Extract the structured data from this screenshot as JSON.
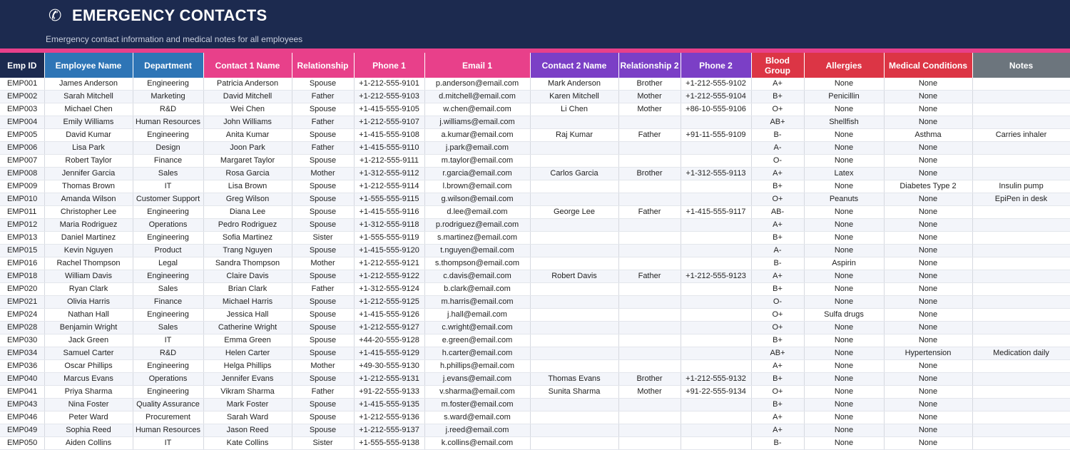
{
  "header": {
    "title": "EMERGENCY CONTACTS",
    "subtitle": "Emergency contact information and medical notes for all employees",
    "icon": "phone-icon"
  },
  "colors": {
    "navy": "#1c2a4f",
    "blue": "#2e75b6",
    "pink": "#e8408a",
    "purple": "#7b3fc6",
    "red": "#dc3545",
    "gray": "#6c757d"
  },
  "table": {
    "columns": [
      {
        "label": "Emp ID",
        "group": "navy"
      },
      {
        "label": "Employee Name",
        "group": "blue"
      },
      {
        "label": "Department",
        "group": "blue"
      },
      {
        "label": "Contact 1 Name",
        "group": "pink"
      },
      {
        "label": "Relationship",
        "group": "pink"
      },
      {
        "label": "Phone 1",
        "group": "pink"
      },
      {
        "label": "Email 1",
        "group": "pink"
      },
      {
        "label": "Contact 2 Name",
        "group": "purple"
      },
      {
        "label": "Relationship 2",
        "group": "purple"
      },
      {
        "label": "Phone 2",
        "group": "purple"
      },
      {
        "label": "Blood Group",
        "group": "red"
      },
      {
        "label": "Allergies",
        "group": "red"
      },
      {
        "label": "Medical Conditions",
        "group": "red"
      },
      {
        "label": "Notes",
        "group": "gray"
      }
    ],
    "rows": [
      [
        "EMP001",
        "James Anderson",
        "Engineering",
        "Patricia Anderson",
        "Spouse",
        "+1-212-555-9101",
        "p.anderson@email.com",
        "Mark Anderson",
        "Brother",
        "+1-212-555-9102",
        "A+",
        "None",
        "None",
        ""
      ],
      [
        "EMP002",
        "Sarah Mitchell",
        "Marketing",
        "David Mitchell",
        "Father",
        "+1-212-555-9103",
        "d.mitchell@email.com",
        "Karen Mitchell",
        "Mother",
        "+1-212-555-9104",
        "B+",
        "Penicillin",
        "None",
        ""
      ],
      [
        "EMP003",
        "Michael Chen",
        "R&D",
        "Wei Chen",
        "Spouse",
        "+1-415-555-9105",
        "w.chen@email.com",
        "Li Chen",
        "Mother",
        "+86-10-555-9106",
        "O+",
        "None",
        "None",
        ""
      ],
      [
        "EMP004",
        "Emily Williams",
        "Human Resources",
        "John Williams",
        "Father",
        "+1-212-555-9107",
        "j.williams@email.com",
        "",
        "",
        "",
        "AB+",
        "Shellfish",
        "None",
        ""
      ],
      [
        "EMP005",
        "David Kumar",
        "Engineering",
        "Anita Kumar",
        "Spouse",
        "+1-415-555-9108",
        "a.kumar@email.com",
        "Raj Kumar",
        "Father",
        "+91-11-555-9109",
        "B-",
        "None",
        "Asthma",
        "Carries inhaler"
      ],
      [
        "EMP006",
        "Lisa Park",
        "Design",
        "Joon Park",
        "Father",
        "+1-415-555-9110",
        "j.park@email.com",
        "",
        "",
        "",
        "A-",
        "None",
        "None",
        ""
      ],
      [
        "EMP007",
        "Robert Taylor",
        "Finance",
        "Margaret Taylor",
        "Spouse",
        "+1-212-555-9111",
        "m.taylor@email.com",
        "",
        "",
        "",
        "O-",
        "None",
        "None",
        ""
      ],
      [
        "EMP008",
        "Jennifer Garcia",
        "Sales",
        "Rosa Garcia",
        "Mother",
        "+1-312-555-9112",
        "r.garcia@email.com",
        "Carlos Garcia",
        "Brother",
        "+1-312-555-9113",
        "A+",
        "Latex",
        "None",
        ""
      ],
      [
        "EMP009",
        "Thomas Brown",
        "IT",
        "Lisa Brown",
        "Spouse",
        "+1-212-555-9114",
        "l.brown@email.com",
        "",
        "",
        "",
        "B+",
        "None",
        "Diabetes Type 2",
        "Insulin pump"
      ],
      [
        "EMP010",
        "Amanda Wilson",
        "Customer Support",
        "Greg Wilson",
        "Spouse",
        "+1-555-555-9115",
        "g.wilson@email.com",
        "",
        "",
        "",
        "O+",
        "Peanuts",
        "None",
        "EpiPen in desk"
      ],
      [
        "EMP011",
        "Christopher Lee",
        "Engineering",
        "Diana Lee",
        "Spouse",
        "+1-415-555-9116",
        "d.lee@email.com",
        "George Lee",
        "Father",
        "+1-415-555-9117",
        "AB-",
        "None",
        "None",
        ""
      ],
      [
        "EMP012",
        "Maria Rodriguez",
        "Operations",
        "Pedro Rodriguez",
        "Spouse",
        "+1-312-555-9118",
        "p.rodriguez@email.com",
        "",
        "",
        "",
        "A+",
        "None",
        "None",
        ""
      ],
      [
        "EMP013",
        "Daniel Martinez",
        "Engineering",
        "Sofia Martinez",
        "Sister",
        "+1-555-555-9119",
        "s.martinez@email.com",
        "",
        "",
        "",
        "B+",
        "None",
        "None",
        ""
      ],
      [
        "EMP015",
        "Kevin Nguyen",
        "Product",
        "Trang Nguyen",
        "Spouse",
        "+1-415-555-9120",
        "t.nguyen@email.com",
        "",
        "",
        "",
        "A-",
        "None",
        "None",
        ""
      ],
      [
        "EMP016",
        "Rachel Thompson",
        "Legal",
        "Sandra Thompson",
        "Mother",
        "+1-212-555-9121",
        "s.thompson@email.com",
        "",
        "",
        "",
        "B-",
        "Aspirin",
        "None",
        ""
      ],
      [
        "EMP018",
        "William Davis",
        "Engineering",
        "Claire Davis",
        "Spouse",
        "+1-212-555-9122",
        "c.davis@email.com",
        "Robert Davis",
        "Father",
        "+1-212-555-9123",
        "A+",
        "None",
        "None",
        ""
      ],
      [
        "EMP020",
        "Ryan Clark",
        "Sales",
        "Brian Clark",
        "Father",
        "+1-312-555-9124",
        "b.clark@email.com",
        "",
        "",
        "",
        "B+",
        "None",
        "None",
        ""
      ],
      [
        "EMP021",
        "Olivia Harris",
        "Finance",
        "Michael Harris",
        "Spouse",
        "+1-212-555-9125",
        "m.harris@email.com",
        "",
        "",
        "",
        "O-",
        "None",
        "None",
        ""
      ],
      [
        "EMP024",
        "Nathan Hall",
        "Engineering",
        "Jessica Hall",
        "Spouse",
        "+1-415-555-9126",
        "j.hall@email.com",
        "",
        "",
        "",
        "O+",
        "Sulfa drugs",
        "None",
        ""
      ],
      [
        "EMP028",
        "Benjamin Wright",
        "Sales",
        "Catherine Wright",
        "Spouse",
        "+1-212-555-9127",
        "c.wright@email.com",
        "",
        "",
        "",
        "O+",
        "None",
        "None",
        ""
      ],
      [
        "EMP030",
        "Jack Green",
        "IT",
        "Emma Green",
        "Spouse",
        "+44-20-555-9128",
        "e.green@email.com",
        "",
        "",
        "",
        "B+",
        "None",
        "None",
        ""
      ],
      [
        "EMP034",
        "Samuel Carter",
        "R&D",
        "Helen Carter",
        "Spouse",
        "+1-415-555-9129",
        "h.carter@email.com",
        "",
        "",
        "",
        "AB+",
        "None",
        "Hypertension",
        "Medication daily"
      ],
      [
        "EMP036",
        "Oscar Phillips",
        "Engineering",
        "Helga Phillips",
        "Mother",
        "+49-30-555-9130",
        "h.phillips@email.com",
        "",
        "",
        "",
        "A+",
        "None",
        "None",
        ""
      ],
      [
        "EMP040",
        "Marcus Evans",
        "Operations",
        "Jennifer Evans",
        "Spouse",
        "+1-212-555-9131",
        "j.evans@email.com",
        "Thomas Evans",
        "Brother",
        "+1-212-555-9132",
        "B+",
        "None",
        "None",
        ""
      ],
      [
        "EMP041",
        "Priya Sharma",
        "Engineering",
        "Vikram Sharma",
        "Father",
        "+91-22-555-9133",
        "v.sharma@email.com",
        "Sunita Sharma",
        "Mother",
        "+91-22-555-9134",
        "O+",
        "None",
        "None",
        ""
      ],
      [
        "EMP043",
        "Nina Foster",
        "Quality Assurance",
        "Mark Foster",
        "Spouse",
        "+1-415-555-9135",
        "m.foster@email.com",
        "",
        "",
        "",
        "B+",
        "None",
        "None",
        ""
      ],
      [
        "EMP046",
        "Peter Ward",
        "Procurement",
        "Sarah Ward",
        "Spouse",
        "+1-212-555-9136",
        "s.ward@email.com",
        "",
        "",
        "",
        "A+",
        "None",
        "None",
        ""
      ],
      [
        "EMP049",
        "Sophia Reed",
        "Human Resources",
        "Jason Reed",
        "Spouse",
        "+1-212-555-9137",
        "j.reed@email.com",
        "",
        "",
        "",
        "A+",
        "None",
        "None",
        ""
      ],
      [
        "EMP050",
        "Aiden Collins",
        "IT",
        "Kate Collins",
        "Sister",
        "+1-555-555-9138",
        "k.collins@email.com",
        "",
        "",
        "",
        "B-",
        "None",
        "None",
        ""
      ]
    ]
  }
}
